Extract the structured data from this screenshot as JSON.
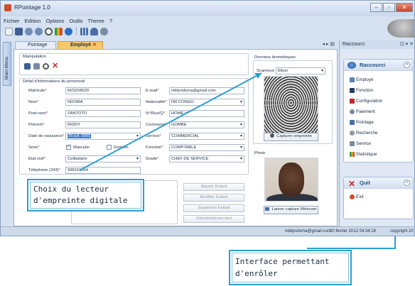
{
  "window": {
    "title": "RPointage 1.0"
  },
  "menu": [
    "Fichier",
    "Edition",
    "Options",
    "Outils",
    "Theme",
    "?"
  ],
  "side_tab": "Main Menu",
  "tabs": [
    {
      "label": "Pointage",
      "active": false
    },
    {
      "label": "Employé",
      "active": true
    }
  ],
  "tab_nav": "◂ ▸ ▤",
  "manipulation": {
    "title": "Manipulation"
  },
  "personal": {
    "title": "Défail d'informations du personnel",
    "matricule_label": "Matricule",
    "matricule": "M/S20452D",
    "nom_label": "Nom",
    "nom": "NDOMA",
    "postnom_label": "Post-nom",
    "postnom": "ZANTOTO",
    "prenom_label": "Prénom",
    "prenom": "RIDDY",
    "naissance_label": "Date de naissance",
    "naissance": "25 juil. 2001",
    "sexe_label": "Sexe",
    "sexe_m": "Masculin",
    "sexe_f": "Feminin",
    "etat_label": "Etat civil",
    "etat": "Celibataire",
    "tel_label": "Téléphone (243)",
    "tel": "998161354",
    "email_label": "E-mail",
    "email": "riddyndoma@gmail.com",
    "nationalite_label": "Nationalité",
    "nationalite": "DR CONGO",
    "rue_label": "N°/Rue/Q",
    "rue": "HOME V",
    "commune_label": "Commune",
    "commune": "GOMBE",
    "service_label": "Service",
    "service": "COMMERCIAL",
    "fonction_label": "Fonction",
    "fonction": "COMPTABLE",
    "grade_label": "Grade",
    "grade": "CHEF DE SERVICE"
  },
  "children_buttons": [
    "Ajouter Enfant",
    "Modifier Enfant",
    "Supprimer Enfant",
    "Déselectionner tout"
  ],
  "biometrics": {
    "title": "Données biométriques",
    "scanner_label": "Scanneur:",
    "scanner_value": "Eikon",
    "capture_button": "Capturer empreinte"
  },
  "photo": {
    "title": "Photo",
    "webcam_button": "Lancer capture Webcam"
  },
  "right_panel": {
    "title": "Raccourci",
    "shortcuts_title": "Raccourci",
    "items": [
      "Employé",
      "Fonction",
      "Configuration",
      "Paiement",
      "Pointage",
      "Recherche",
      "Service",
      "Statistique"
    ],
    "quit_title": "Quit",
    "quit_item": "Exit"
  },
  "status": {
    "email": "riddyndoma@gmail.com",
    "datetime": "20 février 2012 04:34:16",
    "copyright": "copyright 20"
  },
  "callouts": {
    "scanner": "Choix du lecteur\nd'empreinte digitale",
    "enroll": "Interface permettant\nd'enrôler"
  },
  "colors": {
    "accent": "#2c9fcf",
    "active_tab": "#f7c96b",
    "required": "#c0282d"
  }
}
